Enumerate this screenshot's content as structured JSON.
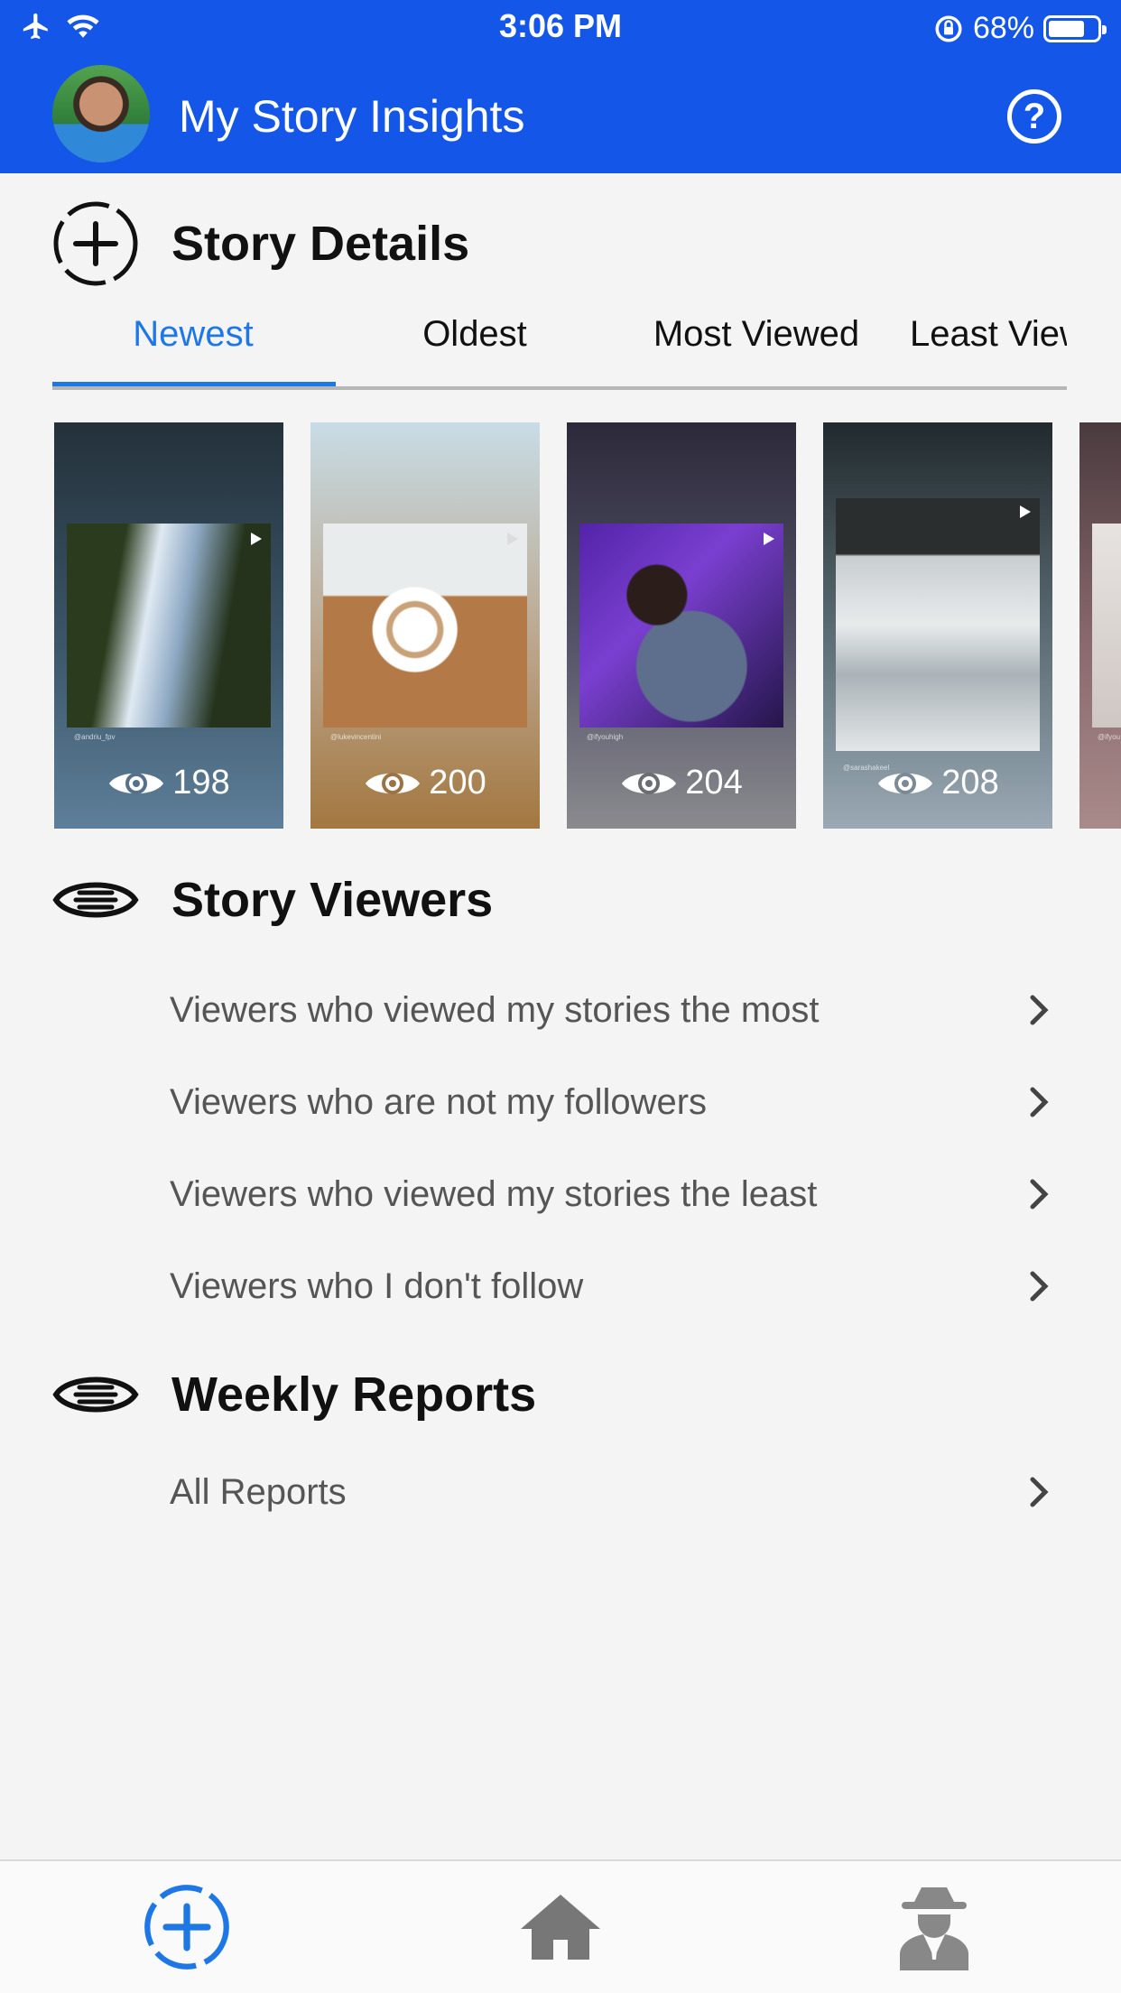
{
  "status_bar": {
    "time": "3:06 PM",
    "battery_percent": "68%",
    "battery_level": 0.68,
    "icons": [
      "airplane-icon",
      "wifi-icon",
      "orientation-lock-icon",
      "battery-icon"
    ]
  },
  "header": {
    "title": "My Story Insights",
    "help_label": "?",
    "brand_color": "#1456e8"
  },
  "story_details": {
    "title": "Story Details",
    "icon": "add-story-icon",
    "tabs": [
      {
        "label": "Newest",
        "active": true
      },
      {
        "label": "Oldest",
        "active": false
      },
      {
        "label": "Most Viewed",
        "active": false
      },
      {
        "label": "Least Viewed",
        "active": false
      }
    ],
    "stories": [
      {
        "views": "198",
        "handle": "@andriu_fpv",
        "theme": "waterfall"
      },
      {
        "views": "200",
        "handle": "@lukevincentini",
        "theme": "coffee"
      },
      {
        "views": "204",
        "handle": "@ifyouhigh",
        "theme": "dancer"
      },
      {
        "views": "208",
        "handle": "@sarashakeel",
        "theme": "snow"
      },
      {
        "views": "",
        "handle": "@ifyou",
        "theme": "pink"
      }
    ]
  },
  "story_viewers": {
    "title": "Story Viewers",
    "icon": "eye-icon",
    "items": [
      {
        "label": "Viewers who viewed my stories the most"
      },
      {
        "label": "Viewers who are not my followers"
      },
      {
        "label": "Viewers who viewed my stories the least"
      },
      {
        "label": "Viewers who I don't follow"
      }
    ]
  },
  "weekly_reports": {
    "title": "Weekly Reports",
    "icon": "eye-icon",
    "items": [
      {
        "label": "All Reports"
      }
    ]
  },
  "bottom_nav": {
    "items": [
      {
        "icon": "add-story-icon",
        "active": true,
        "color": "#1d78e6"
      },
      {
        "icon": "home-icon",
        "active": false,
        "color": "#777777"
      },
      {
        "icon": "spy-icon",
        "active": false,
        "color": "#888888"
      }
    ]
  }
}
